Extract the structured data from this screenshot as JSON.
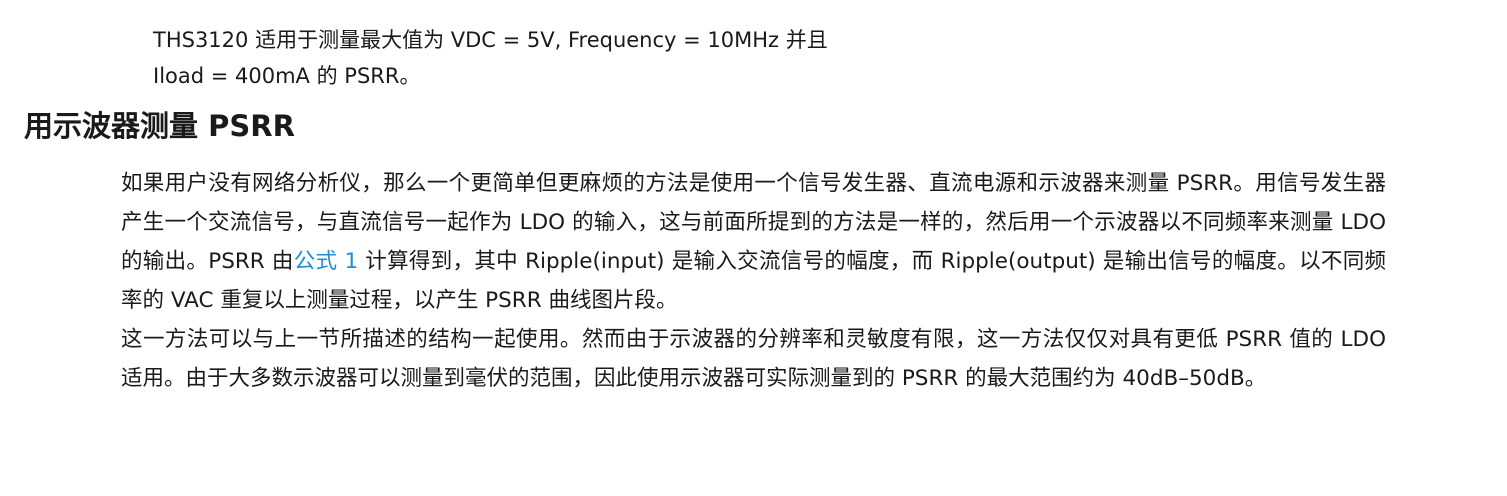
{
  "top_paragraph": {
    "line1": "THS3120 适用于测量最大值为 VDC = 5V, Frequency = 10MHz 并且",
    "line2": "Iload = 400mA 的 PSRR。"
  },
  "section": {
    "heading": "用示波器测量 PSRR"
  },
  "paragraph1": {
    "text_before_link": "如果用户没有网络分析仪，那么一个更简单但更麻烦的方法是使用一个信号发生器、直流电源和示波器来测量 PSRR。用信号发生器产生一个交流信号，与直流信号一起作为 LDO 的输入，这与前面所提到的方法是一样的，然后用一个示波器以不同频率来测量 LDO 的输出。PSRR 由",
    "link_text": "公式 1",
    "text_after_link": " 计算得到，其中 Ripple(input) 是输入交流信号的幅度，而 Ripple(output) 是输出信号的幅度。以不同频率的 VAC 重复以上测量过程，以产生 PSRR 曲线图片段。"
  },
  "paragraph2": {
    "text": "这一方法可以与上一节所描述的结构一起使用。然而由于示波器的分辨率和灵敏度有限，这一方法仅仅对具有更低 PSRR 值的 LDO 适用。由于大多数示波器可以测量到毫伏的范围，因此使用示波器可实际测量到的 PSRR 的最大范围约为 40dB–50dB。"
  },
  "colors": {
    "link": "#1e8fd6",
    "text": "#1a1a1a"
  }
}
